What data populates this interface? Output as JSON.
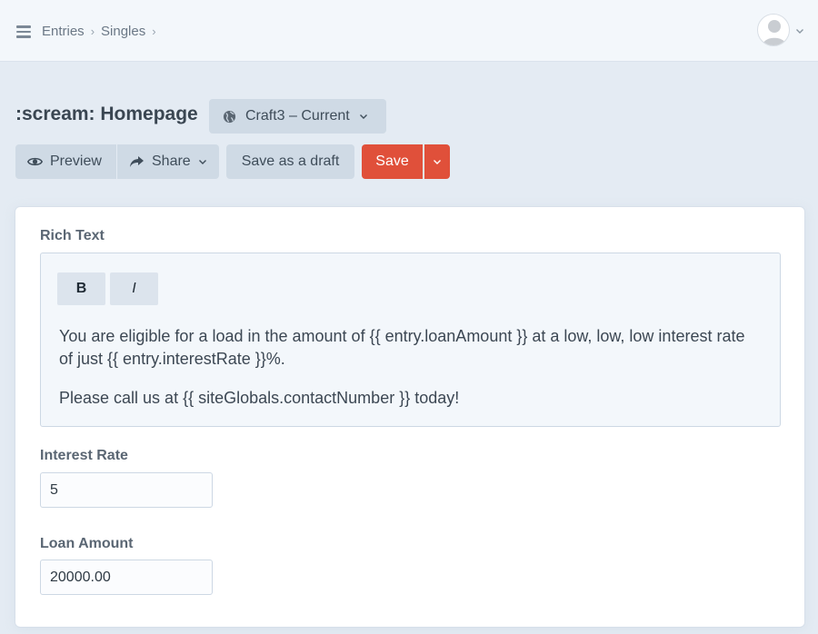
{
  "header": {
    "breadcrumbs": [
      "Entries",
      "Singles"
    ],
    "menu_icon": "hamburger-icon",
    "avatar_icon": "user-avatar"
  },
  "title_row": {
    "title": ":scream: Homepage",
    "site_menu_label": "Craft3 – Current",
    "site_menu_icon": "globe-icon"
  },
  "actions": {
    "preview_label": "Preview",
    "preview_icon": "eye-icon",
    "share_label": "Share",
    "share_icon": "share-arrow-icon",
    "draft_label": "Save as a draft",
    "save_label": "Save",
    "save_color": "#e0503a"
  },
  "fields": {
    "rich_text": {
      "label": "Rich Text",
      "bold_label": "B",
      "italic_label": "I",
      "paragraphs": [
        "You are eligible for a load in the amount of {{ entry.loanAmount }} at a low, low, low interest rate of just {{ entry.interestRate }}%.",
        "Please call us at {{ siteGlobals.contactNumber }} today!"
      ]
    },
    "interest_rate": {
      "label": "Interest Rate",
      "value": "5"
    },
    "loan_amount": {
      "label": "Loan Amount",
      "value": "20000.00"
    }
  }
}
